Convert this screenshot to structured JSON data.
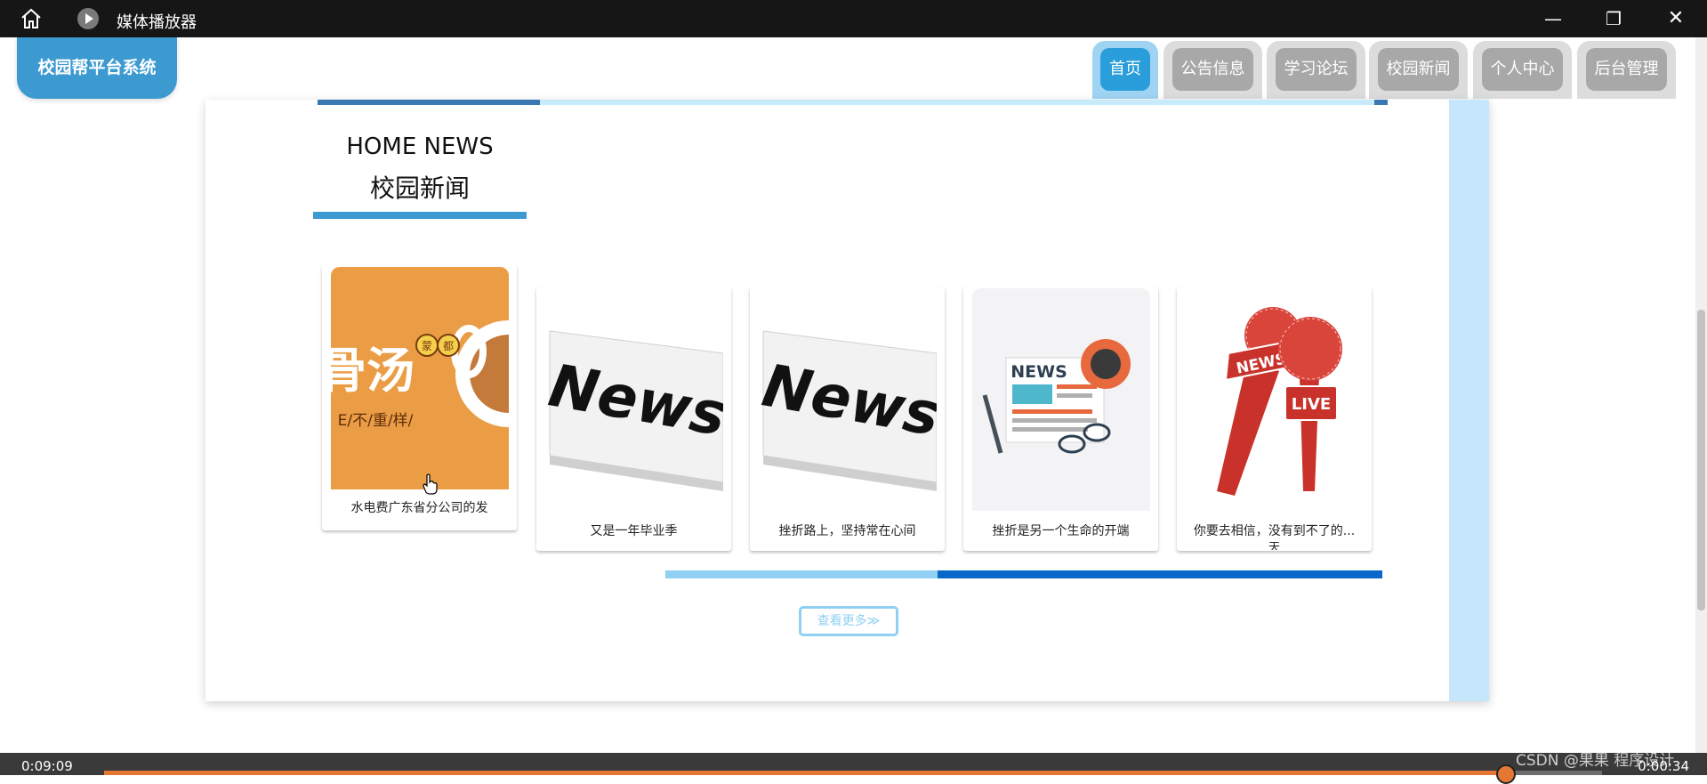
{
  "window": {
    "title": "媒体播放器",
    "controls": [
      "minimize-icon",
      "maximize-icon",
      "close-icon"
    ],
    "minimize": "—",
    "maximize": "❐",
    "close": "✕"
  },
  "site": {
    "logo": "校园帮平台系统",
    "nav": [
      {
        "label": "首页",
        "active": true
      },
      {
        "label": "公告信息",
        "active": false
      },
      {
        "label": "学习论坛",
        "active": false
      },
      {
        "label": "校园新闻",
        "active": false
      },
      {
        "label": "个人中心",
        "active": false
      },
      {
        "label": "后台管理",
        "active": false
      }
    ]
  },
  "section": {
    "title_en": "HOME NEWS",
    "title_zh": "校园新闻"
  },
  "news": [
    {
      "caption": "水电费广东省分公司的发",
      "image": "bone-soup-poster",
      "image_text": "骨汤",
      "image_badge": "蒙都",
      "image_sub": "E/不/重/样/"
    },
    {
      "caption": "又是一年毕业季",
      "image": "newspaper-news",
      "image_text": "News"
    },
    {
      "caption": "挫折路上，坚持常在心间",
      "image": "newspaper-news",
      "image_text": "News"
    },
    {
      "caption": "挫折是另一个生命的开端",
      "image": "news-desk-illustration",
      "image_text": "NEWS"
    },
    {
      "caption": "你要去相信，没有到不了的...",
      "caption2": "天",
      "image": "news-microphones",
      "image_text": "NEWS",
      "image_live": "LIVE"
    }
  ],
  "more_button": "查看更多≫",
  "colors": {
    "accent": "#3d9ad1",
    "nav_active": "#2a9ddb",
    "nav_inactive": "#a8a8a8",
    "slider_light": "#8fd0f3",
    "slider_dark": "#0868c9",
    "player_progress": "#e47733"
  },
  "player": {
    "elapsed": "0:09:09",
    "duration": "0:00:34",
    "progress": 0.93
  },
  "watermark": "CSDN @果果 程序设计"
}
